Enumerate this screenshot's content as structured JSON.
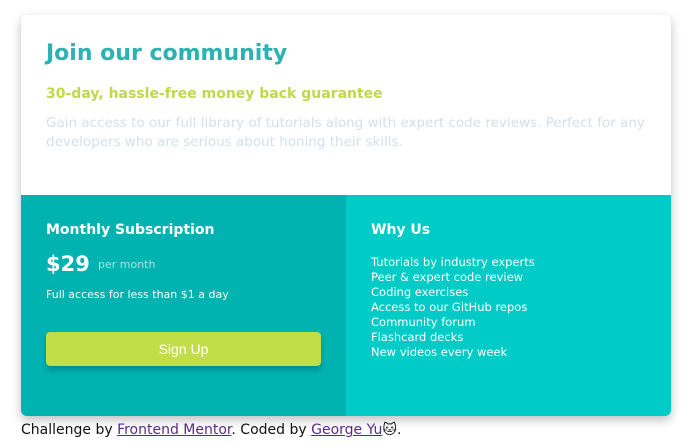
{
  "header": {
    "title": "Join our community",
    "subtitle": "30-day, hassle-free money back guarantee",
    "description": "Gain access to our full library of tutorials along with expert code reviews. Perfect for any developers who are serious about honing their skills."
  },
  "subscription": {
    "heading": "Monthly Subscription",
    "price": "$29",
    "period": "per month",
    "note": "Full access for less than $1 a day",
    "button": "Sign Up"
  },
  "why": {
    "heading": "Why Us",
    "items": [
      "Tutorials by industry experts",
      "Peer & expert code review",
      "Coding exercises",
      "Access to our GitHub repos",
      "Community forum",
      "Flashcard decks",
      "New videos every week"
    ]
  },
  "footer": {
    "prefix": "Challenge by ",
    "link1": "Frontend Mentor",
    "middle": ". Coded by ",
    "link2": "George Yu",
    "emoji": "🐱",
    "suffix": "."
  },
  "colors": {
    "teal_dark": "#00b2b0",
    "teal_light": "#00cbc7",
    "lime": "#c2dd47",
    "title": "#2bb3b1"
  }
}
